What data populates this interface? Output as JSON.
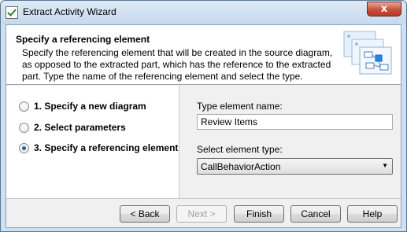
{
  "window": {
    "title": "Extract Activity Wizard",
    "close_glyph": "x"
  },
  "header": {
    "title": "Specify a referencing element",
    "description": "Specify the referencing element that will be created in the source diagram, as opposed to the extracted part, which has the reference to the extracted part. Type the name of the referencing element and select the type."
  },
  "steps": [
    {
      "label": "1. Specify a new diagram",
      "selected": false
    },
    {
      "label": "2. Select parameters",
      "selected": false
    },
    {
      "label": "3. Specify a referencing element",
      "selected": true
    }
  ],
  "form": {
    "name_label": "Type element name:",
    "name_value": "Review Items",
    "type_label": "Select element type:",
    "type_value": "CallBehaviorAction"
  },
  "buttons": {
    "back": "< Back",
    "next": "Next >",
    "finish": "Finish",
    "cancel": "Cancel",
    "help": "Help"
  },
  "colors": {
    "accent": "#2a5d9c",
    "close_button": "#c7503a"
  }
}
